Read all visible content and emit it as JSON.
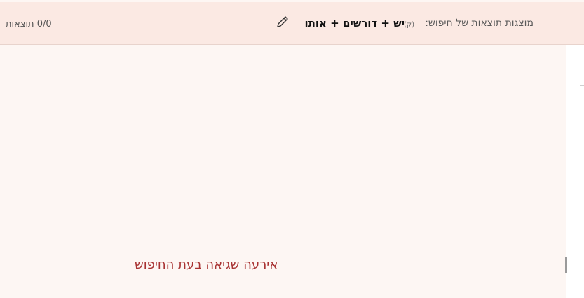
{
  "header": {
    "search_label": "מוצגות תוצאות של חיפוש:",
    "query_indicator": "(ק)",
    "query_text": "יש + דורשים + אותו",
    "results_count": "0/0 תוצאות",
    "edit_icon": "pencil-icon"
  },
  "content": {
    "error_message": "אירעה שגיאה בעת החיפוש"
  },
  "colors": {
    "header_background": "#fbe9e3",
    "page_background": "#fdf6f3",
    "error_text": "#a83232"
  }
}
